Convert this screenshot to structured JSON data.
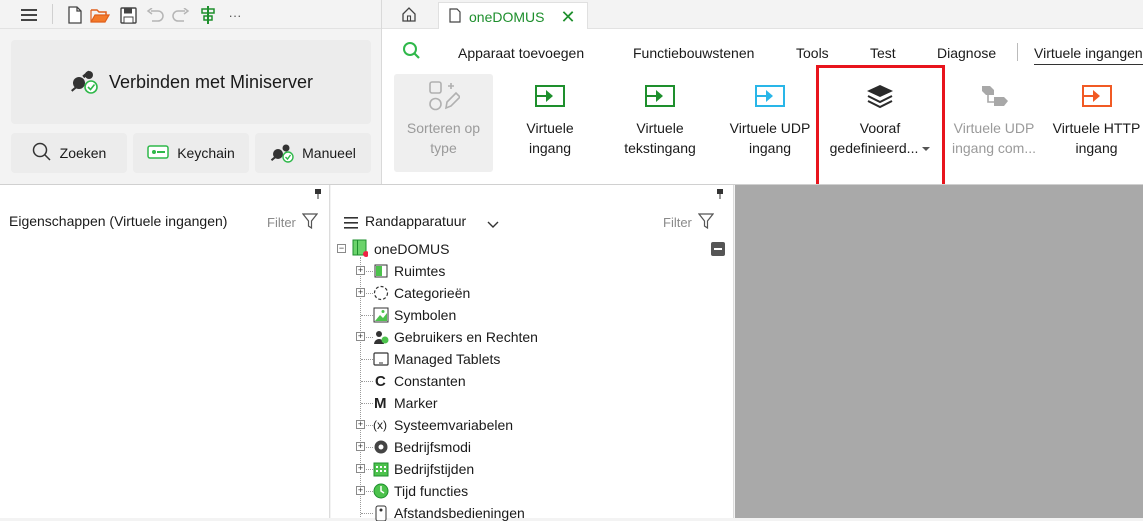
{
  "toolbar": {
    "icons": [
      "menu-icon",
      "new-file-icon",
      "open-folder-icon",
      "save-icon",
      "undo-icon",
      "redo-icon",
      "align-icon",
      "more-icon"
    ],
    "more_label": "···"
  },
  "connect": {
    "main_label": "Verbinden met Miniserver",
    "search_label": "Zoeken",
    "keychain_label": "Keychain",
    "manual_label": "Manueel"
  },
  "tabs": {
    "home_icon": "home-icon",
    "document_title": "oneDOMUS",
    "close_glyph": "✕"
  },
  "ribbon": {
    "menu": [
      "Apparaat toevoegen",
      "Functiebouwstenen",
      "Tools",
      "Test",
      "Diagnose",
      "Virtuele ingangen"
    ],
    "buttons": [
      {
        "line1": "Sorteren op",
        "line2": "type",
        "disabled": true
      },
      {
        "line1": "Virtuele",
        "line2": "ingang",
        "disabled": false
      },
      {
        "line1": "Virtuele",
        "line2": "tekstingang",
        "disabled": false
      },
      {
        "line1": "Virtuele UDP",
        "line2": "ingang",
        "disabled": false
      },
      {
        "line1": "Vooraf",
        "line2": "gedefinieerd...",
        "disabled": false
      },
      {
        "line1": "Virtuele UDP",
        "line2": "ingang com...",
        "disabled": true
      },
      {
        "line1": "Virtuele HTTP",
        "line2": "ingang",
        "disabled": false
      }
    ]
  },
  "properties": {
    "title": "Eigenschappen (Virtuele ingangen)",
    "filter_label": "Filter"
  },
  "periphery": {
    "title": "Randapparatuur",
    "filter_label": "Filter",
    "root": "oneDOMUS",
    "items": [
      {
        "label": "Ruimtes",
        "expandable": true,
        "icon": "rooms-icon"
      },
      {
        "label": "Categorieën",
        "expandable": true,
        "icon": "categories-icon"
      },
      {
        "label": "Symbolen",
        "expandable": false,
        "icon": "symbols-icon"
      },
      {
        "label": "Gebruikers en Rechten",
        "expandable": true,
        "icon": "users-icon"
      },
      {
        "label": "Managed Tablets",
        "expandable": false,
        "icon": "tablet-icon"
      },
      {
        "label": "Constanten",
        "expandable": false,
        "icon": "constants-icon"
      },
      {
        "label": "Marker",
        "expandable": false,
        "icon": "marker-icon"
      },
      {
        "label": "Systeemvariabelen",
        "expandable": true,
        "icon": "system-variables-icon"
      },
      {
        "label": "Bedrijfsmodi",
        "expandable": true,
        "icon": "operating-modes-icon"
      },
      {
        "label": "Bedrijfstijden",
        "expandable": true,
        "icon": "operating-times-icon"
      },
      {
        "label": "Tijd functies",
        "expandable": true,
        "icon": "time-functions-icon"
      },
      {
        "label": "Afstandsbedieningen",
        "expandable": false,
        "icon": "remote-controls-icon"
      }
    ]
  },
  "colors": {
    "accent_green": "#1e8f2d",
    "highlight_red": "#e8141c",
    "icon_orange": "#f15a24",
    "icon_cyan": "#29b6e8"
  }
}
